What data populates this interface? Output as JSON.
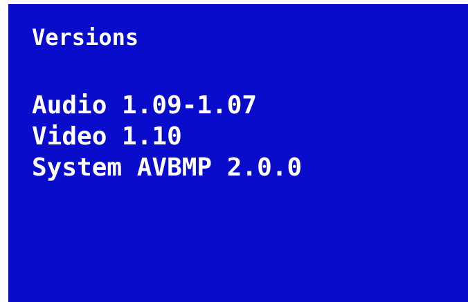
{
  "screen": {
    "title": "Versions",
    "lines": [
      "Audio 1.09-1.07",
      "Video 1.10",
      "System AVBMP 2.0.0"
    ],
    "background_color": "#0a0ccc",
    "text_color": "#ffffff"
  }
}
